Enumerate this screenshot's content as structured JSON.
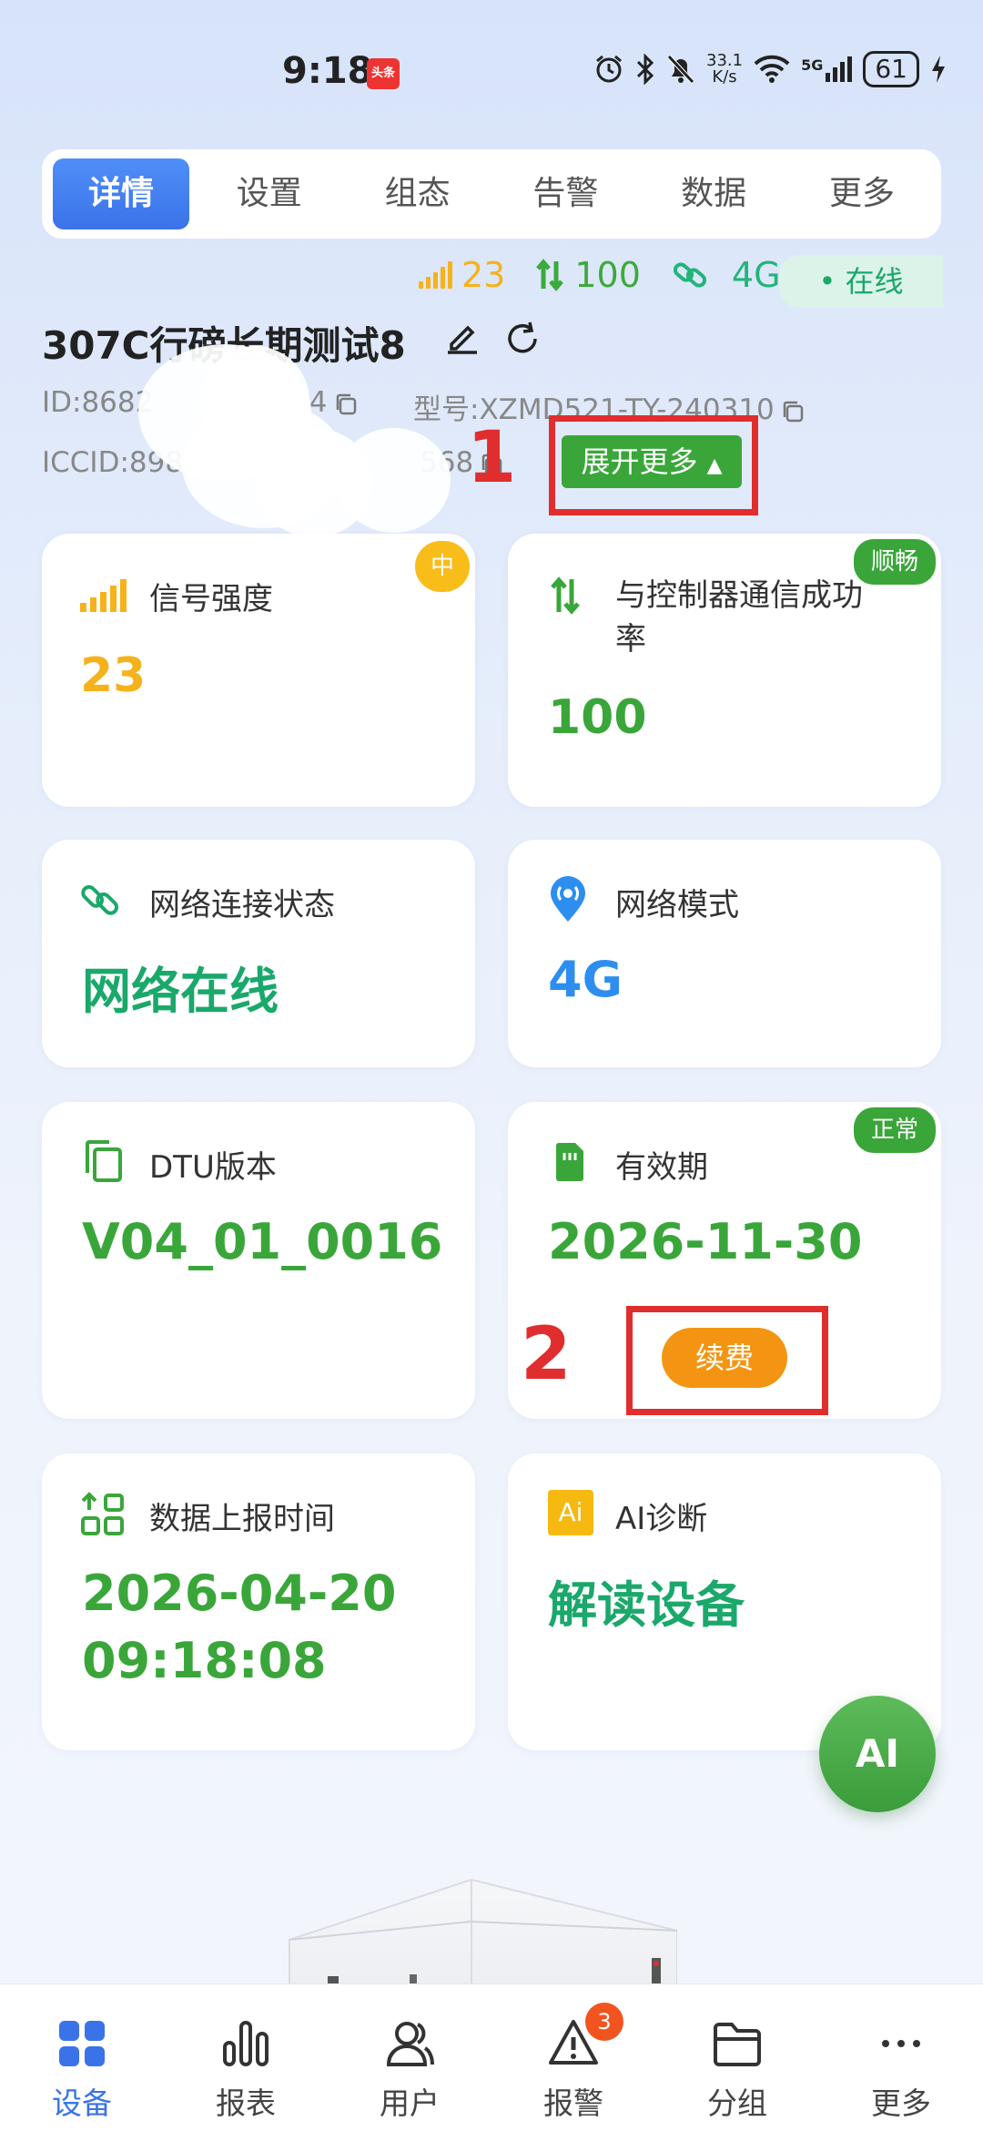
{
  "status_bar": {
    "time": "9:18",
    "news_badge": "头条",
    "speed_value": "33.1",
    "speed_unit": "K/s",
    "network": "5G",
    "battery": "61"
  },
  "tabs": [
    {
      "label": "详情",
      "active": true
    },
    {
      "label": "设置"
    },
    {
      "label": "组态"
    },
    {
      "label": "告警"
    },
    {
      "label": "数据"
    },
    {
      "label": "更多"
    }
  ],
  "summary": {
    "signal": "23",
    "success_rate": "100",
    "mode": "4G",
    "online": "在线"
  },
  "device": {
    "name": "307C行磅长期测试8",
    "id_text": "ID:8682",
    "id_tail": "274",
    "model_text": "型号:XZMD521-TY-240310",
    "iccid_text": "ICCID:898",
    "iccid_tail": "568",
    "expand_label": "展开更多"
  },
  "annotations": {
    "first": "1",
    "second": "2"
  },
  "cards": {
    "signal": {
      "title": "信号强度",
      "value": "23",
      "badge": "中"
    },
    "comm": {
      "title": "与控制器通信成功率",
      "value": "100",
      "badge": "顺畅"
    },
    "net_status": {
      "title": "网络连接状态",
      "value": "网络在线"
    },
    "net_mode": {
      "title": "网络模式",
      "value": "4G"
    },
    "dtu": {
      "title": "DTU版本",
      "value": "V04_01_0016"
    },
    "validity": {
      "title": "有效期",
      "value": "2026-11-30",
      "badge": "正常",
      "renew": "续费"
    },
    "report_time": {
      "title": "数据上报时间",
      "value_date": "2026-04-20",
      "value_time": "09:18:08"
    },
    "ai": {
      "title": "AI诊断",
      "icon_text": "Ai",
      "value": "解读设备"
    }
  },
  "ai_fab": "AI",
  "bottom_nav": [
    {
      "label": "设备",
      "active": true
    },
    {
      "label": "报表"
    },
    {
      "label": "用户"
    },
    {
      "label": "报警",
      "badge": "3"
    },
    {
      "label": "分组"
    },
    {
      "label": "更多"
    }
  ],
  "colors": {
    "primary_blue": "#3a73e8",
    "green": "#3aa63a",
    "teal": "#1aa86b",
    "orange": "#f6b21c",
    "red_annotation": "#e02d2d"
  }
}
